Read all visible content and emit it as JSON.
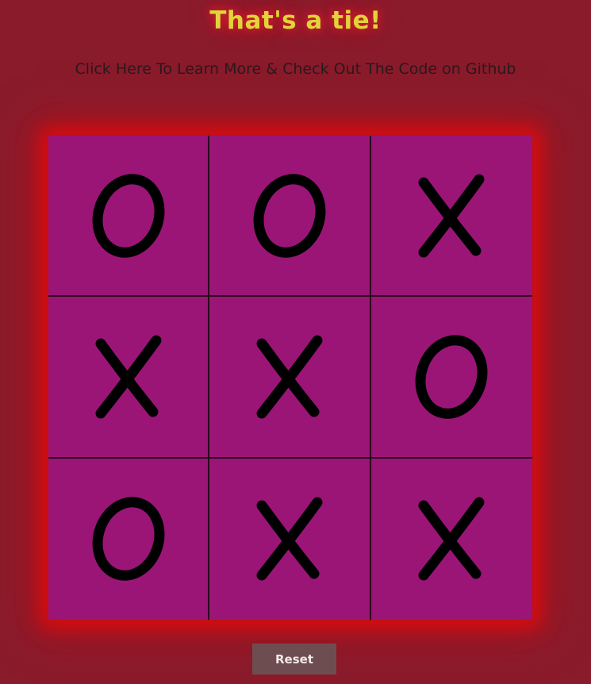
{
  "status": {
    "text": "That's a tie!"
  },
  "link": {
    "text": "Click Here To Learn More & Check Out The Code on Github"
  },
  "board": {
    "cells": [
      "O",
      "O",
      "X",
      "X",
      "X",
      "O",
      "O",
      "X",
      "X"
    ]
  },
  "reset": {
    "label": "Reset"
  }
}
